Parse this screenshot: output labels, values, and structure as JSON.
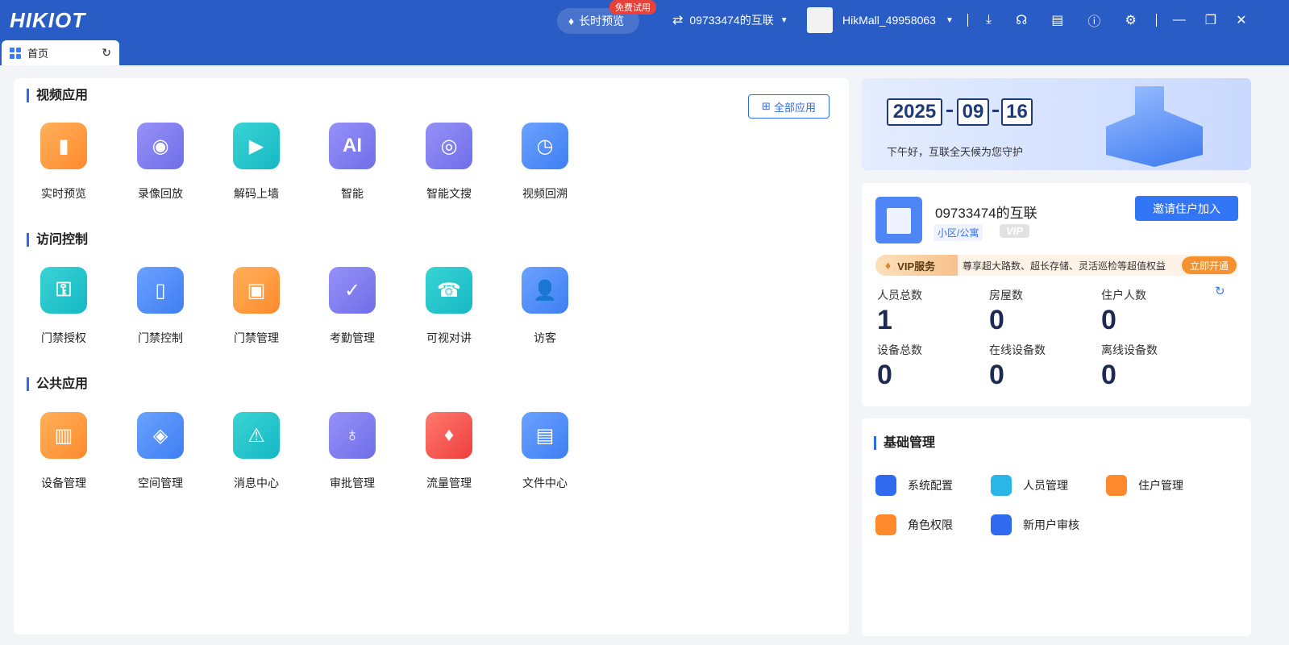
{
  "header": {
    "logo": "HIKIOT",
    "trial_badge": "免费试用",
    "long_preview": "长时预览",
    "org": "09733474的互联",
    "user": "HikMall_49958063"
  },
  "tabs": [
    {
      "label": "首页"
    }
  ],
  "sections": [
    {
      "title": "视频应用",
      "apps": [
        {
          "label": "实时预览",
          "color": "o",
          "glyph": "▮"
        },
        {
          "label": "录像回放",
          "color": "p",
          "glyph": "◉"
        },
        {
          "label": "解码上墙",
          "color": "t",
          "glyph": "▶"
        },
        {
          "label": "智能",
          "color": "p",
          "glyph": "AI"
        },
        {
          "label": "智能文搜",
          "color": "p",
          "glyph": "◎"
        },
        {
          "label": "视频回溯",
          "color": "b",
          "glyph": "◷"
        }
      ]
    },
    {
      "title": "访问控制",
      "apps": [
        {
          "label": "门禁授权",
          "color": "t",
          "glyph": "⚿"
        },
        {
          "label": "门禁控制",
          "color": "b",
          "glyph": "▯"
        },
        {
          "label": "门禁管理",
          "color": "o",
          "glyph": "▣"
        },
        {
          "label": "考勤管理",
          "color": "p",
          "glyph": "✓"
        },
        {
          "label": "可视对讲",
          "color": "t",
          "glyph": "☎"
        },
        {
          "label": "访客",
          "color": "b",
          "glyph": "👤"
        }
      ]
    },
    {
      "title": "公共应用",
      "apps": [
        {
          "label": "设备管理",
          "color": "o",
          "glyph": "▥"
        },
        {
          "label": "空间管理",
          "color": "b",
          "glyph": "◈"
        },
        {
          "label": "消息中心",
          "color": "t",
          "glyph": "⚠"
        },
        {
          "label": "审批管理",
          "color": "p",
          "glyph": "♁"
        },
        {
          "label": "流量管理",
          "color": "r",
          "glyph": "♦"
        },
        {
          "label": "文件中心",
          "color": "b",
          "glyph": "▤"
        }
      ]
    }
  ],
  "all_apps": "全部应用",
  "banner": {
    "year": "2025",
    "month": "09",
    "day": "16",
    "greeting": "下午好，互联全天候为您守护"
  },
  "org_card": {
    "name": "09733474的互联",
    "type_tag": "小区/公寓",
    "vip_tag": "VIP",
    "invite": "邀请住户加入",
    "vip_title": "VIP服务",
    "vip_desc": "尊享超大路数、超长存储、灵活巡检等超值权益",
    "vip_open": "立即开通",
    "stats": [
      {
        "label": "人员总数",
        "value": "1"
      },
      {
        "label": "房屋数",
        "value": "0"
      },
      {
        "label": "住户人数",
        "value": "0"
      },
      {
        "label": "设备总数",
        "value": "0"
      },
      {
        "label": "在线设备数",
        "value": "0"
      },
      {
        "label": "离线设备数",
        "value": "0"
      }
    ]
  },
  "basic": {
    "title": "基础管理",
    "items": [
      {
        "label": "系统配置",
        "color": "#2f6bef"
      },
      {
        "label": "人员管理",
        "color": "#2bb6e8"
      },
      {
        "label": "住户管理",
        "color": "#ff8a2e"
      },
      {
        "label": "角色权限",
        "color": "#ff8a2e"
      },
      {
        "label": "新用户审核",
        "color": "#2f6bef"
      }
    ]
  }
}
